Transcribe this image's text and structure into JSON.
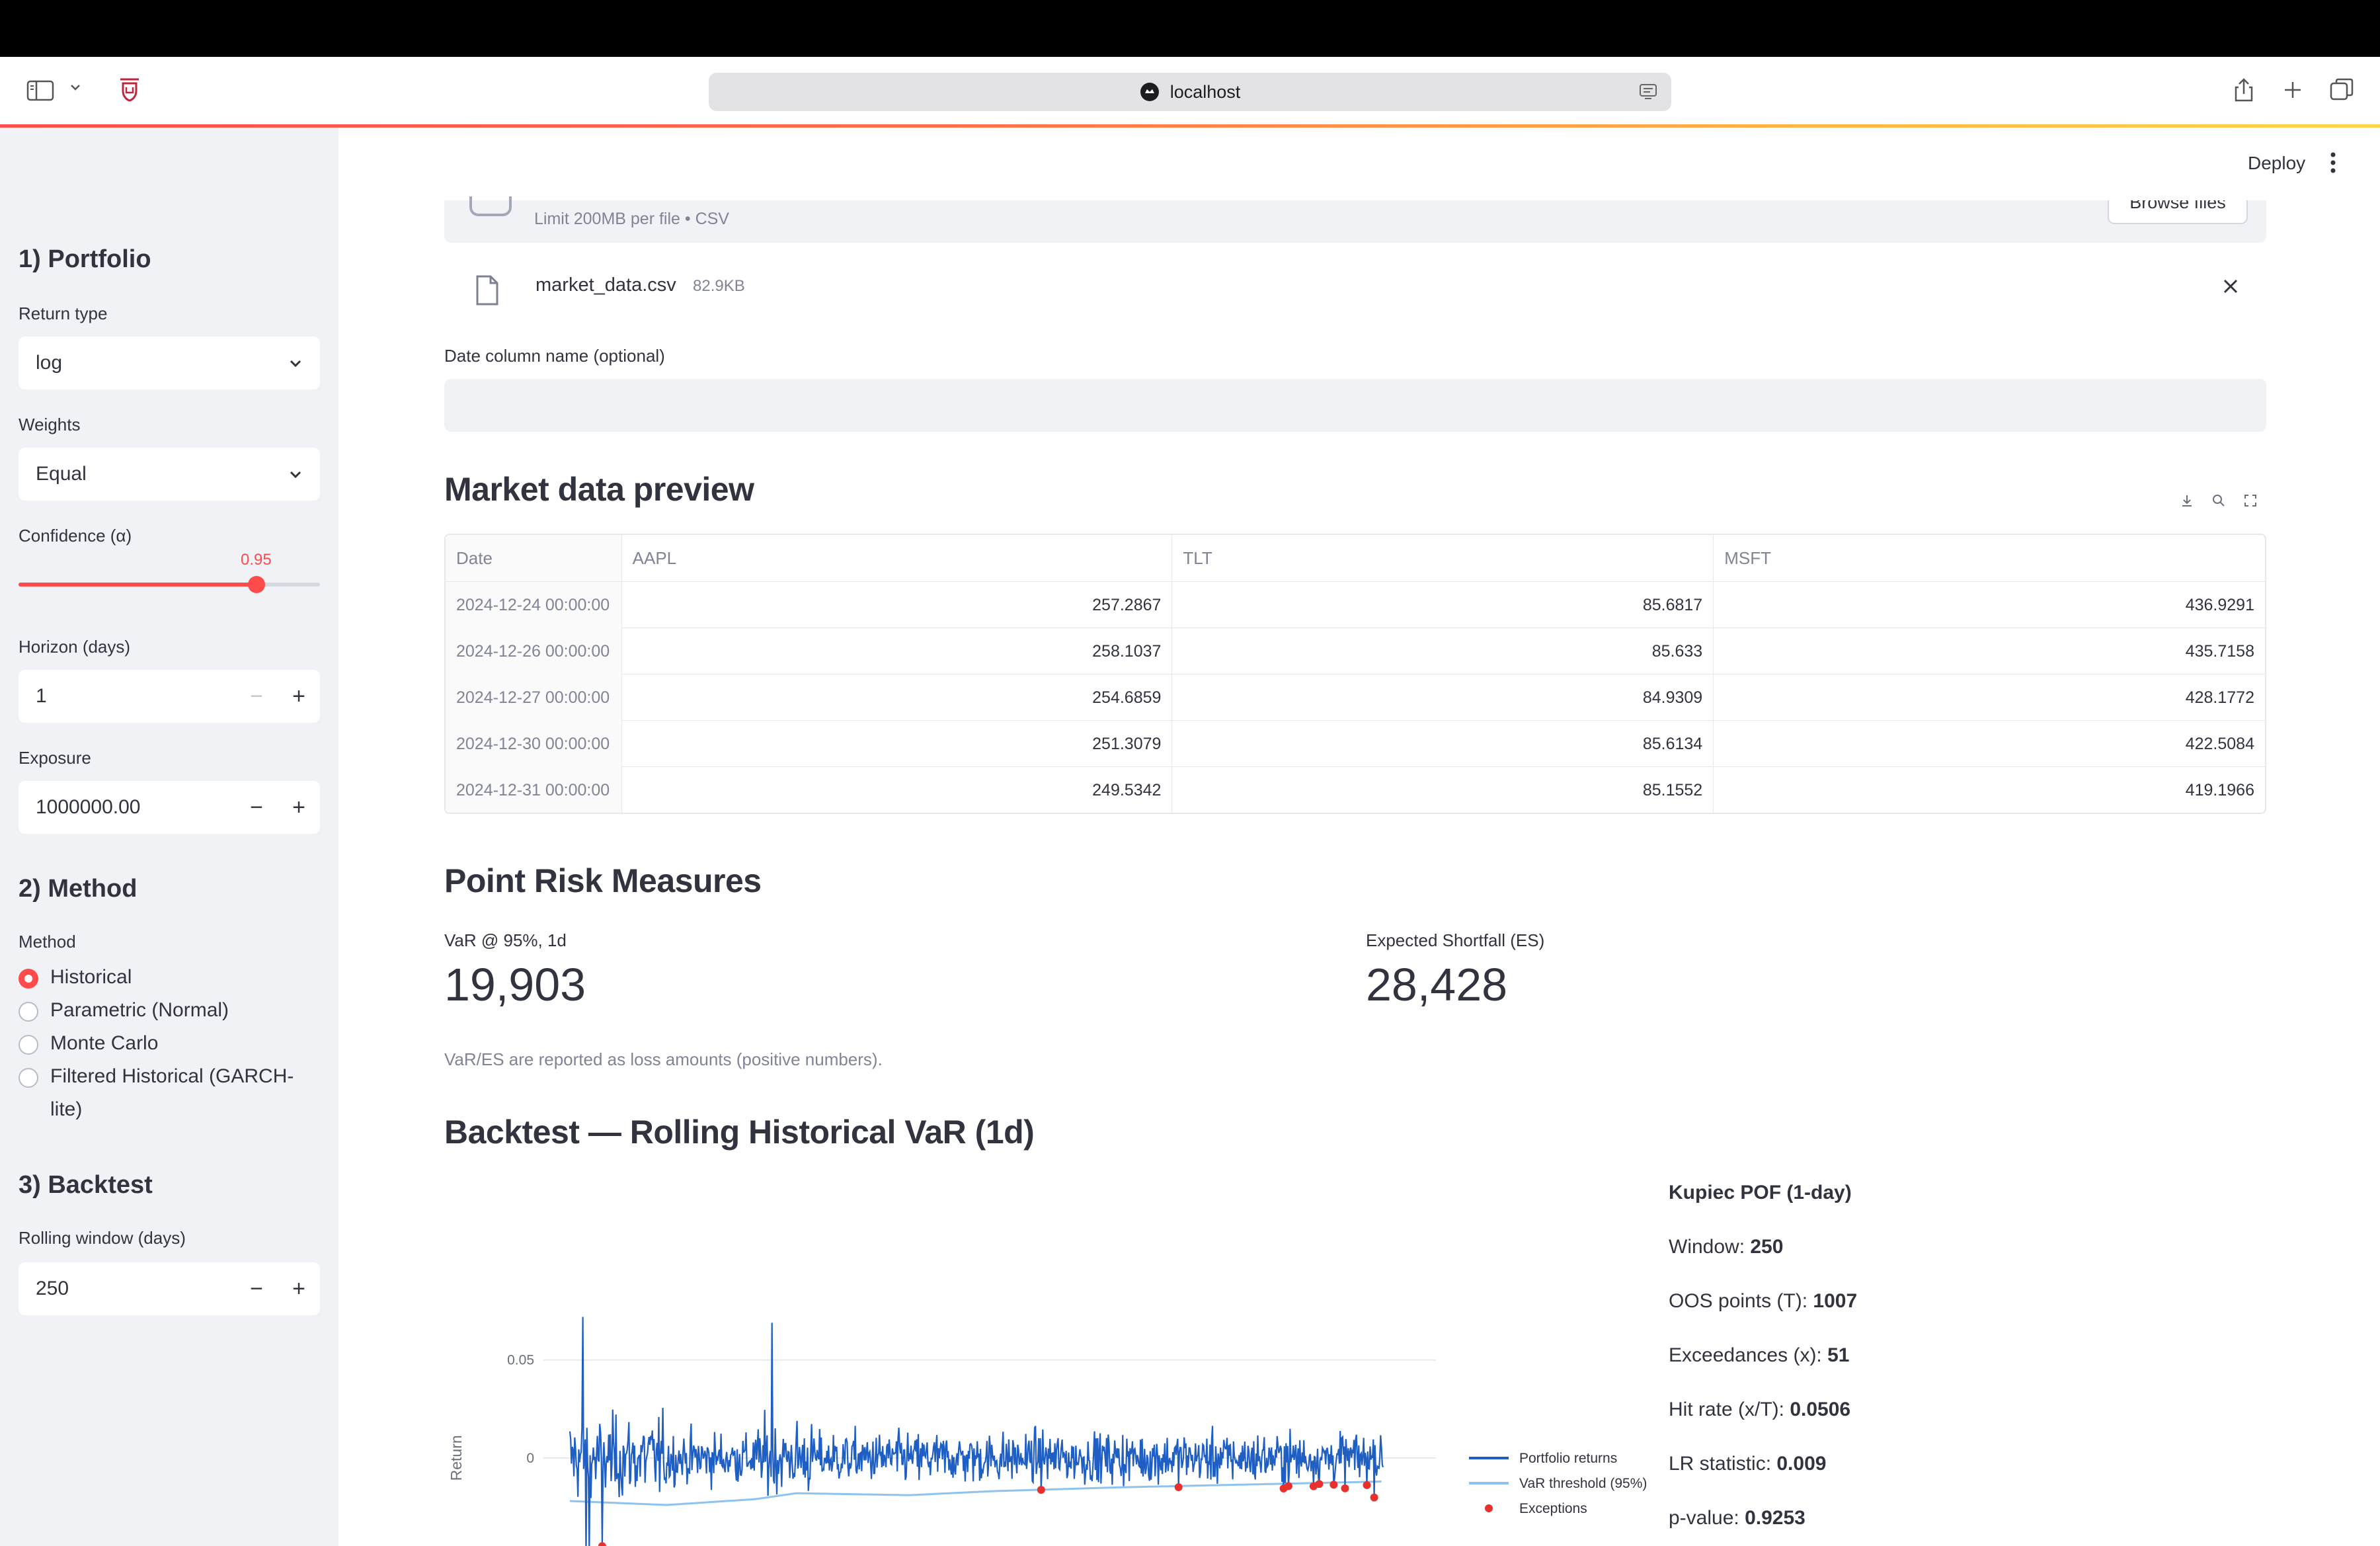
{
  "browser": {
    "url": "localhost"
  },
  "header": {
    "deploy_label": "Deploy"
  },
  "sidebar": {
    "portfolio_heading": "1) Portfolio",
    "return_type": {
      "label": "Return type",
      "value": "log"
    },
    "weights": {
      "label": "Weights",
      "value": "Equal"
    },
    "confidence": {
      "label": "Confidence (α)",
      "value_text": "0.95",
      "min": 0.8,
      "max": 0.99,
      "value": 0.95
    },
    "horizon": {
      "label": "Horizon (days)",
      "value": "1",
      "minus": "−",
      "plus": "+"
    },
    "exposure": {
      "label": "Exposure",
      "value": "1000000.00",
      "minus": "−",
      "plus": "+"
    },
    "method_heading": "2) Method",
    "method": {
      "label": "Method",
      "options": [
        "Historical",
        "Parametric (Normal)",
        "Monte Carlo",
        "Filtered Historical (GARCH-lite)"
      ],
      "selected_index": 0
    },
    "backtest_heading": "3) Backtest",
    "rolling_window": {
      "label": "Rolling window (days)",
      "value": "250",
      "minus": "−",
      "plus": "+"
    }
  },
  "uploader": {
    "limit_text": "Limit 200MB per file • CSV",
    "browse_label": "Browse files",
    "file_name": "market_data.csv",
    "file_size": "82.9KB"
  },
  "date_column": {
    "label": "Date column name (optional)",
    "value": ""
  },
  "preview": {
    "heading": "Market data preview",
    "columns": [
      "Date",
      "AAPL",
      "TLT",
      "MSFT"
    ],
    "rows": [
      [
        "2024-12-24 00:00:00",
        "257.2867",
        "85.6817",
        "436.9291"
      ],
      [
        "2024-12-26 00:00:00",
        "258.1037",
        "85.633",
        "435.7158"
      ],
      [
        "2024-12-27 00:00:00",
        "254.6859",
        "84.9309",
        "428.1772"
      ],
      [
        "2024-12-30 00:00:00",
        "251.3079",
        "85.6134",
        "422.5084"
      ],
      [
        "2024-12-31 00:00:00",
        "249.5342",
        "85.1552",
        "419.1966"
      ]
    ]
  },
  "point_risk": {
    "heading": "Point Risk Measures",
    "var_label": "VaR @ 95%, 1d",
    "var_value": "19,903",
    "es_label": "Expected Shortfall (ES)",
    "es_value": "28,428",
    "caption": "VaR/ES are reported as loss amounts (positive numbers)."
  },
  "backtest": {
    "heading": "Backtest — Rolling Historical VaR (1d)",
    "kupiec": {
      "title": "Kupiec POF (1-day)",
      "lines": [
        {
          "label": "Window: ",
          "value": "250"
        },
        {
          "label": "OOS points (T): ",
          "value": "1007"
        },
        {
          "label": "Exceedances (x): ",
          "value": "51"
        },
        {
          "label": "Hit rate (x/T): ",
          "value": "0.0506"
        },
        {
          "label": "LR statistic: ",
          "value": "0.009"
        },
        {
          "label": "p-value: ",
          "value": "0.9253"
        }
      ]
    }
  },
  "chart_data": {
    "type": "line",
    "ylabel": "Return",
    "yticks": [
      0.05,
      0
    ],
    "ylim": [
      -0.05,
      0.085
    ],
    "x_points": 1007,
    "series": [
      {
        "name": "Portfolio returns",
        "color": "#1f5fc4",
        "kind": "line",
        "value_range": [
          -0.05,
          0.072
        ],
        "spikes": [
          {
            "x": 16,
            "value": 0.072
          },
          {
            "x": 250,
            "value": 0.069
          }
        ]
      },
      {
        "name": "VaR threshold (95%)",
        "color": "#8ec3f0",
        "kind": "line",
        "values_at": [
          [
            0,
            -0.022
          ],
          [
            120,
            -0.024
          ],
          [
            230,
            -0.021
          ],
          [
            280,
            -0.018
          ],
          [
            420,
            -0.019
          ],
          [
            520,
            -0.017
          ],
          [
            680,
            -0.015
          ],
          [
            900,
            -0.013
          ],
          [
            1006,
            -0.012
          ]
        ]
      },
      {
        "name": "Exceptions",
        "color": "#e8302e",
        "kind": "markers",
        "count": 51
      }
    ],
    "legend_position": "top-right",
    "grid": true
  }
}
